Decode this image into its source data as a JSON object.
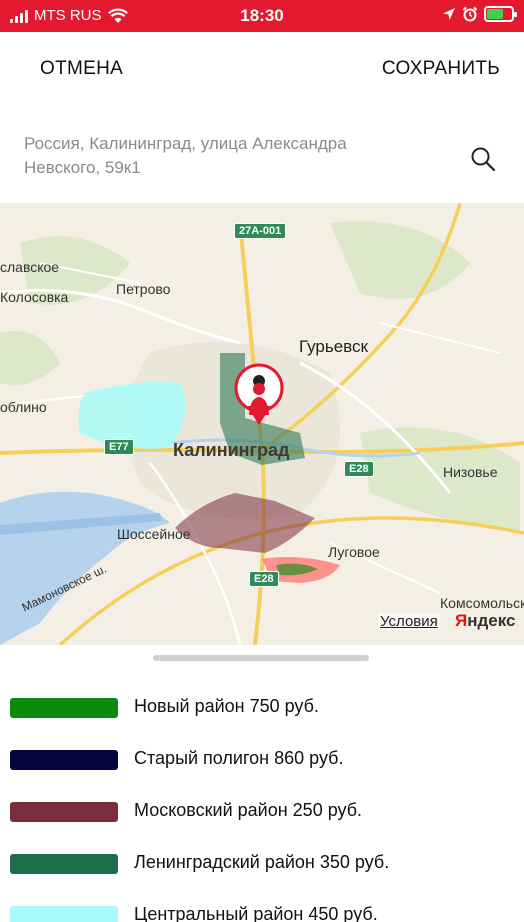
{
  "status_bar": {
    "carrier": "MTS RUS",
    "time": "18:30",
    "background": "#e3192f"
  },
  "header": {
    "cancel_label": "ОТМЕНА",
    "save_label": "СОХРАНИТЬ"
  },
  "search": {
    "address": "Россия, Калининград, улица Александра Невского, 59к1",
    "icon": "search-icon"
  },
  "map": {
    "labels": {
      "slavskoe": "славское",
      "kolosovka": "Колосовка",
      "petrovo": "Петрово",
      "gurevsk": "Гурьевск",
      "oblino": "облино",
      "kaliningrad": "Калининград",
      "nizovye": "Низовье",
      "shosseynoe": "Шоссейное",
      "lugovoe": "Луговое",
      "mamonovskoe": "Мамоновское ш.",
      "komsomolsk": "Комсомольск"
    },
    "roads": {
      "r27a": "27А-001",
      "e77": "E77",
      "e28_east": "E28",
      "e28_south": "E28"
    },
    "terms_label": "Условия",
    "brand_first": "Я",
    "brand_rest": "ндекс",
    "pin_icon": "user-location-pin-icon"
  },
  "legend": [
    {
      "label": "Новый район 750 руб.",
      "color": "#0a8a0a"
    },
    {
      "label": "Старый полигон 860 руб.",
      "color": "#050540"
    },
    {
      "label": "Московский район 250 руб.",
      "color": "#7a2e3e"
    },
    {
      "label": "Ленинградский район 350 руб.",
      "color": "#1f6e4c"
    },
    {
      "label": "Центральный район 450 руб.",
      "color": "#a7fbf8"
    }
  ]
}
